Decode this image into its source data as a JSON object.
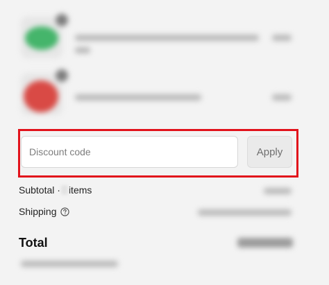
{
  "discount": {
    "placeholder": "Discount code",
    "apply_label": "Apply"
  },
  "summary": {
    "subtotal_label": "Subtotal ·",
    "items_label": "items",
    "shipping_label": "Shipping",
    "total_label": "Total"
  },
  "icons": {
    "shipping_help": "question-circle-icon"
  },
  "colors": {
    "highlight": "#e2121b",
    "background": "#f3f3f3"
  }
}
